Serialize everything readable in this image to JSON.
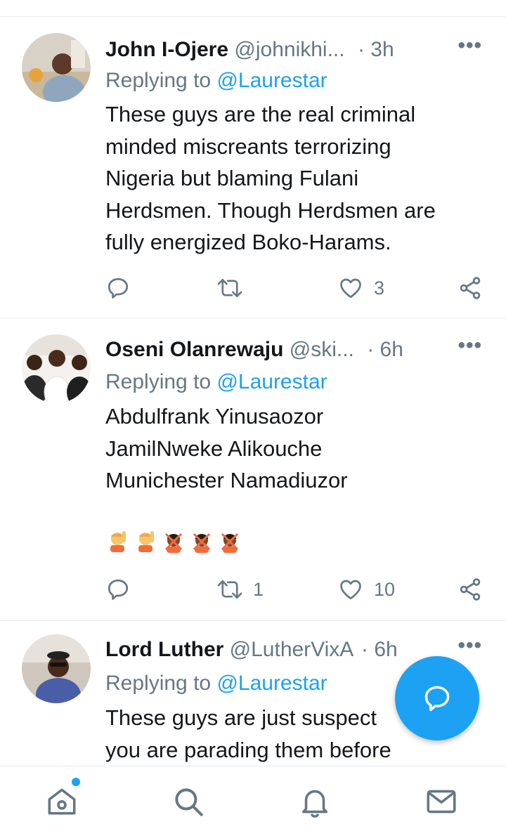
{
  "tweets": [
    {
      "name": "John I-Ojere",
      "handle": "@johnikhi...",
      "time": "· 3h",
      "replying_label": "Replying to",
      "replying_to": "@Laurestar",
      "lines": [
        "These guys are the real criminal",
        "minded miscreants terrorizing",
        "Nigeria but blaming Fulani",
        "Herdsmen. Though Herdsmen are",
        "fully energized Boko-Harams."
      ],
      "replies": "",
      "retweets": "",
      "likes": "3"
    },
    {
      "name": "Oseni Olanrewaju",
      "handle": "@ski...",
      "time": "· 6h",
      "replying_label": "Replying to",
      "replying_to": "@Laurestar",
      "lines": [
        "Abdulfrank Yinusaozor",
        "JamilNweke Alikouche",
        "Munichester Namadiuzor"
      ],
      "emojis": [
        "person-raising-hand-light",
        "person-raising-hand-light",
        "person-gesturing-no-dark",
        "person-gesturing-no-dark",
        "person-gesturing-no-dark"
      ],
      "replies": "",
      "retweets": "1",
      "likes": "10"
    },
    {
      "name": "Lord Luther",
      "handle": "@LutherVixA",
      "time": "· 6h",
      "replying_label": "Replying to",
      "replying_to": "@Laurestar",
      "lines": [
        "These guys are just suspect",
        "you are parading them before"
      ]
    }
  ],
  "more_label": "•••",
  "icons": {
    "reply": "reply-icon",
    "retweet": "retweet-icon",
    "like": "heart-icon",
    "share": "share-icon",
    "compose": "compose-reply-icon",
    "home": "home-icon",
    "search": "search-icon",
    "notifications": "bell-icon",
    "messages": "mail-icon"
  },
  "colors": {
    "accent": "#1da1f2",
    "secondary_text": "#657786",
    "primary_text": "#14171a",
    "divider": "#e6ecf0"
  }
}
